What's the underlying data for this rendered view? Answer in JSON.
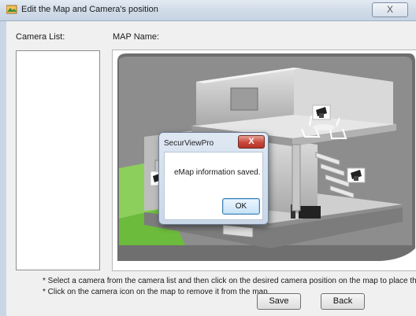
{
  "window": {
    "title": "Edit the Map and Camera's position",
    "close_glyph": "X"
  },
  "labels": {
    "camera_list": "Camera List:",
    "map_name": "MAP Name:"
  },
  "map": {
    "image": "3d-house-floorplan"
  },
  "dialog": {
    "title": "SecurViewPro",
    "close_glyph": "X",
    "message": "eMap information saved.",
    "ok_label": "OK"
  },
  "notes": [
    "* Select a camera from the camera list and then click on the desired camera position on the map to place the ca",
    "* Click on the camera icon on the map to remove it from the map."
  ],
  "buttons": {
    "save": "Save",
    "back": "Back"
  },
  "icons": {
    "app": "map-icon",
    "camera": "camera-icon"
  }
}
